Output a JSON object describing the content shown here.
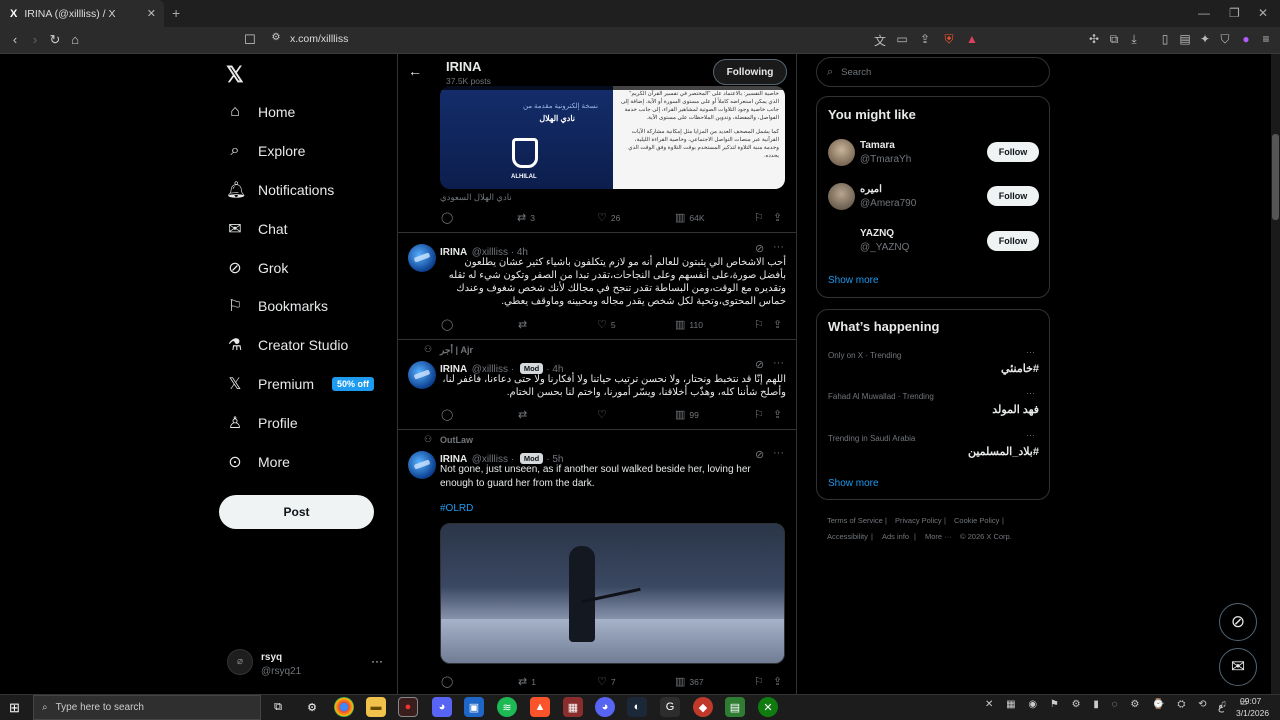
{
  "browser": {
    "tab_title": "IRINA (@xillliss) / X",
    "tab_logo": "X",
    "url": "x.com/xillliss"
  },
  "nav": {
    "items": [
      {
        "label": "Home",
        "icon": "home-icon"
      },
      {
        "label": "Explore",
        "icon": "search-icon"
      },
      {
        "label": "Notifications",
        "icon": "bell-icon"
      },
      {
        "label": "Chat",
        "icon": "mail-icon"
      },
      {
        "label": "Grok",
        "icon": "grok-icon"
      },
      {
        "label": "Bookmarks",
        "icon": "bookmark-icon"
      },
      {
        "label": "Creator Studio",
        "icon": "flask-icon"
      },
      {
        "label": "Premium",
        "icon": "x-icon"
      },
      {
        "label": "Profile",
        "icon": "person-icon"
      },
      {
        "label": "More",
        "icon": "more-circle-icon"
      }
    ],
    "premium_badge": "50% off",
    "post_button": "Post",
    "account_name": "rsyq",
    "account_handle": "@rsyq21"
  },
  "profile_header": {
    "name": "IRINA",
    "posts": "37.5K posts",
    "following_button": "Following"
  },
  "tweet0": {
    "card_caption": "نادي الهلال السعودي",
    "card_left_text": "نسخة إلكترونية مقدمة من",
    "card_left_title": "نادي الهلال",
    "card_logo_text": "ALHILAL",
    "card_right_p1": "خاصية التفسير: بالاعتماد على \"المختصر في تفسير القرآن الكريم\" الذي يمكن استعراضه كاملاً أو على مستوى السورة أو الآية. إضافة إلى جانب خاصية وجود التلاوات الصوتية لمشاهير القراء، إلى جانب خدمة الفواصل، والمفضلة، وتدوين الملاحظات على مستوى الآية.",
    "card_right_p2": "كما يشمل المصحف العديد من المزايا مثل إمكانية مشاركة الآيات القرآنية عبر منصات التواصل الاجتماعي، وخاصية القراءة الليلية، وخدمة منبة التلاوة لتذكير المستخدم بوقت التلاوة وفق الوقت الذي يحدده.",
    "replies": "",
    "retweets": "3",
    "likes": "26",
    "views": "64K"
  },
  "tweet1": {
    "name": "IRINA",
    "handle": "@xillliss",
    "time": "4h",
    "text": "أحب الاشخاص الي يثبتون للعالم أنه مو لازم يتكلفون باشياء كثير عشان يطلعون بأفضل صورة،على أنفسهم وعلى النجاحات،تقدر تبدا من الصفر وتكون شيء له ثقله وتقديره مع الوقت،ومن البساطة تقدر تنجح في مجالك لأنك شخص شغوف وعندك حماس المحتوى،وتحية لكل شخص يقدر مجاله ومحبينه وماوقف يعطي.",
    "replies": "",
    "retweets": "",
    "likes": "5",
    "views": "110"
  },
  "tweet2": {
    "context": "أجر | Ajr",
    "name": "IRINA",
    "handle": "@xillliss",
    "mod": "Mod",
    "time": "4h",
    "text": "اللهم إنّا قد نتخبط ونحتار، ولا نحسن ترتيب حياتنا ولا أفكارنا ولا حتى دعاءنا، فاغفر لنا، وأصلح شأننا كله، وهذّب أخلاقنا، ويسّر أمورنا، واختم لنا بحسن الختام.",
    "replies": "",
    "retweets": "",
    "likes": "",
    "views": "99"
  },
  "tweet3": {
    "context": "OutLaw",
    "name": "IRINA",
    "handle": "@xillliss",
    "mod": "Mod",
    "time": "5h",
    "text": "Not gone, just unseen, as if another soul walked beside her, loving her enough to guard her from the dark.",
    "hashtag": "#OLRD",
    "replies": "",
    "retweets": "1",
    "likes": "7",
    "views": "367"
  },
  "search": {
    "placeholder": "Search"
  },
  "you_might_like": {
    "title": "You might like",
    "users": [
      {
        "name": "Tamara",
        "handle": "@TmaraYh",
        "button": "Follow"
      },
      {
        "name": "اميره",
        "handle": "@Amera790",
        "button": "Follow"
      },
      {
        "name": "YAZNQ",
        "handle": "@_YAZNQ",
        "button": "Follow"
      }
    ],
    "show_more": "Show more"
  },
  "whats_happening": {
    "title": "What’s happening",
    "trends": [
      {
        "context": "Only on X · Trending",
        "name": "#خامنئي"
      },
      {
        "context": "Fahad Al Muwallad · Trending",
        "name": "فهد المولد"
      },
      {
        "context": "Trending in Saudi Arabia",
        "name": "#بلاد_المسلمين"
      }
    ],
    "show_more": "Show more"
  },
  "footer": {
    "links": [
      "Terms of Service",
      "Privacy Policy",
      "Cookie Policy",
      "Accessibility",
      "Ads info",
      "More ···"
    ],
    "copyright": "© 2026 X Corp."
  },
  "taskbar": {
    "search_placeholder": "Type here to search",
    "time": "09:07",
    "date": "3/1/2026",
    "lang": "ع"
  },
  "colors": {
    "accent": "#1d9bf0",
    "bg": "#000000",
    "border": "#2f3336",
    "muted": "#71767b"
  }
}
